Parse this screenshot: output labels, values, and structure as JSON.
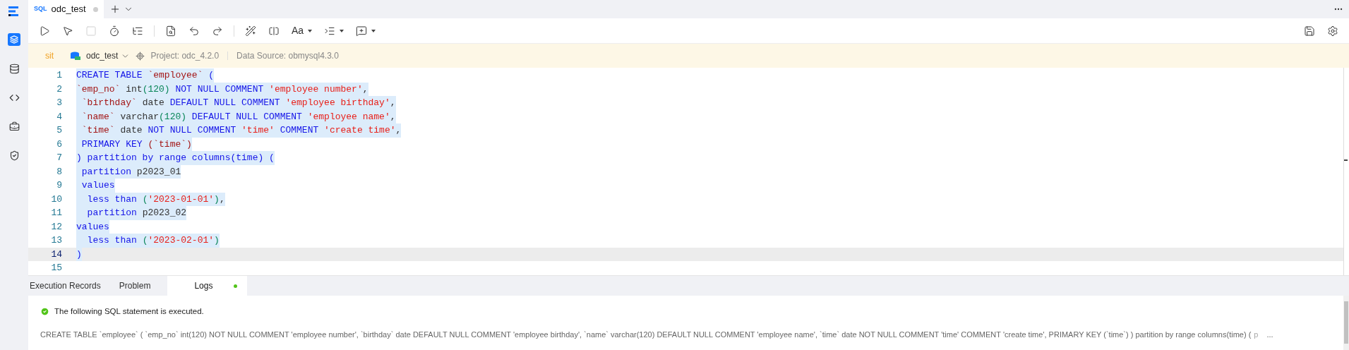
{
  "sidebar": {
    "items": [
      {
        "kind": "layers",
        "selected": true
      },
      {
        "kind": "database",
        "selected": false
      },
      {
        "kind": "code",
        "selected": false
      },
      {
        "kind": "toolbox",
        "selected": false
      },
      {
        "kind": "shield",
        "selected": false
      }
    ]
  },
  "tabs": [
    {
      "badge": "SQL",
      "label": "odc_test",
      "selected": true,
      "modified": true
    }
  ],
  "toolbar": {
    "left": [
      {
        "kind": "run",
        "disabled": false
      },
      {
        "kind": "run-selected",
        "disabled": false
      },
      {
        "kind": "stop",
        "disabled": true
      },
      {
        "kind": "timer",
        "disabled": false
      },
      {
        "kind": "tree",
        "disabled": false
      },
      {
        "kind": "divider"
      },
      {
        "kind": "find",
        "disabled": false
      },
      {
        "kind": "undo",
        "disabled": false
      },
      {
        "kind": "redo",
        "disabled": false
      },
      {
        "kind": "divider"
      },
      {
        "kind": "wand",
        "disabled": false
      },
      {
        "kind": "format",
        "disabled": false
      },
      {
        "kind": "font",
        "label": "Aa",
        "dropdown": true,
        "disabled": false
      },
      {
        "kind": "indent",
        "dropdown": true,
        "disabled": false
      },
      {
        "kind": "comment",
        "dropdown": true,
        "disabled": false
      }
    ],
    "right": [
      {
        "kind": "save",
        "disabled": false
      },
      {
        "kind": "settings",
        "disabled": false
      }
    ]
  },
  "info_bar": {
    "environment": "sit",
    "database": "odc_test",
    "project": "Project: odc_4.2.0",
    "data_source": "Data Source: obmysql4.3.0"
  },
  "editor": {
    "lines": [
      {
        "number": "1",
        "selected": true,
        "current": false,
        "tokens": [
          {
            "kind": "keyword",
            "text": "CREATE TABLE "
          },
          {
            "kind": "ident",
            "text": "`employee`"
          },
          {
            "kind": "keyword",
            "text": " ("
          }
        ]
      },
      {
        "number": "2",
        "selected": true,
        "current": false,
        "tokens": [
          {
            "kind": "ident",
            "text": "`emp_no`"
          },
          {
            "kind": "plain",
            "text": " int"
          },
          {
            "kind": "number",
            "text": "(120)"
          },
          {
            "kind": "keyword",
            "text": " NOT NULL COMMENT "
          },
          {
            "kind": "string",
            "text": "'employee number'"
          },
          {
            "kind": "plain",
            "text": ","
          }
        ]
      },
      {
        "number": "3",
        "selected": true,
        "current": false,
        "tokens": [
          {
            "kind": "ident",
            "text": " `birthday`"
          },
          {
            "kind": "plain",
            "text": " date "
          },
          {
            "kind": "keyword",
            "text": "DEFAULT NULL COMMENT "
          },
          {
            "kind": "string",
            "text": "'employee birthday'"
          },
          {
            "kind": "plain",
            "text": ","
          }
        ]
      },
      {
        "number": "4",
        "selected": true,
        "current": false,
        "tokens": [
          {
            "kind": "ident",
            "text": " `name`"
          },
          {
            "kind": "plain",
            "text": " varchar"
          },
          {
            "kind": "number",
            "text": "(120)"
          },
          {
            "kind": "keyword",
            "text": " DEFAULT NULL COMMENT "
          },
          {
            "kind": "string",
            "text": "'employee name'"
          },
          {
            "kind": "plain",
            "text": ","
          }
        ]
      },
      {
        "number": "5",
        "selected": true,
        "current": false,
        "tokens": [
          {
            "kind": "ident",
            "text": " `time`"
          },
          {
            "kind": "plain",
            "text": " date "
          },
          {
            "kind": "keyword",
            "text": "NOT NULL COMMENT "
          },
          {
            "kind": "string",
            "text": "'time'"
          },
          {
            "kind": "keyword",
            "text": " COMMENT "
          },
          {
            "kind": "string",
            "text": "'create time'"
          },
          {
            "kind": "plain",
            "text": ","
          }
        ]
      },
      {
        "number": "6",
        "selected": true,
        "current": false,
        "tokens": [
          {
            "kind": "keyword",
            "text": " PRIMARY KEY "
          },
          {
            "kind": "ident",
            "text": "(`time`)"
          }
        ]
      },
      {
        "number": "7",
        "selected": true,
        "current": false,
        "tokens": [
          {
            "kind": "keyword",
            "text": ") partition by range columns(time) ("
          }
        ]
      },
      {
        "number": "8",
        "selected": true,
        "current": false,
        "tokens": [
          {
            "kind": "keyword",
            "text": " partition "
          },
          {
            "kind": "plain",
            "text": "p2023_01"
          }
        ]
      },
      {
        "number": "9",
        "selected": true,
        "current": false,
        "tokens": [
          {
            "kind": "keyword",
            "text": " values"
          }
        ]
      },
      {
        "number": "10",
        "selected": true,
        "current": false,
        "tokens": [
          {
            "kind": "keyword",
            "text": "  less than "
          },
          {
            "kind": "number",
            "text": "("
          },
          {
            "kind": "string",
            "text": "'2023-01-01'"
          },
          {
            "kind": "number",
            "text": ")"
          },
          {
            "kind": "plain",
            "text": ","
          }
        ]
      },
      {
        "number": "11",
        "selected": true,
        "current": false,
        "tokens": [
          {
            "kind": "keyword",
            "text": "  partition "
          },
          {
            "kind": "plain",
            "text": "p2023_02"
          }
        ]
      },
      {
        "number": "12",
        "selected": true,
        "current": false,
        "tokens": [
          {
            "kind": "keyword",
            "text": "values"
          }
        ]
      },
      {
        "number": "13",
        "selected": true,
        "current": false,
        "tokens": [
          {
            "kind": "keyword",
            "text": "  less than "
          },
          {
            "kind": "number",
            "text": "("
          },
          {
            "kind": "string",
            "text": "'2023-02-01'"
          },
          {
            "kind": "number",
            "text": ")"
          }
        ]
      },
      {
        "number": "14",
        "selected": true,
        "current": true,
        "tokens": [
          {
            "kind": "keyword",
            "text": ")"
          }
        ]
      },
      {
        "number": "15",
        "current": false
      }
    ]
  },
  "bottom_panel": {
    "tabs": [
      {
        "label": "Execution Records",
        "selected": false,
        "status": false
      },
      {
        "label": "Problem",
        "selected": false,
        "status": false
      },
      {
        "label": "Logs",
        "selected": true,
        "status": true
      }
    ],
    "log": {
      "message": "The following SQL statement is executed.",
      "sql": "CREATE TABLE `employee` ( `emp_no` int(120) NOT NULL COMMENT 'employee number', `birthday` date DEFAULT NULL COMMENT 'employee birthday', `name` varchar(120) DEFAULT NULL COMMENT 'employee name', `time` date NOT NULL COMMENT 'time' COMMENT 'create time', PRIMARY KEY (`time`) ) partition by range columns(time) (",
      "faded": "p",
      "more": "..."
    }
  }
}
